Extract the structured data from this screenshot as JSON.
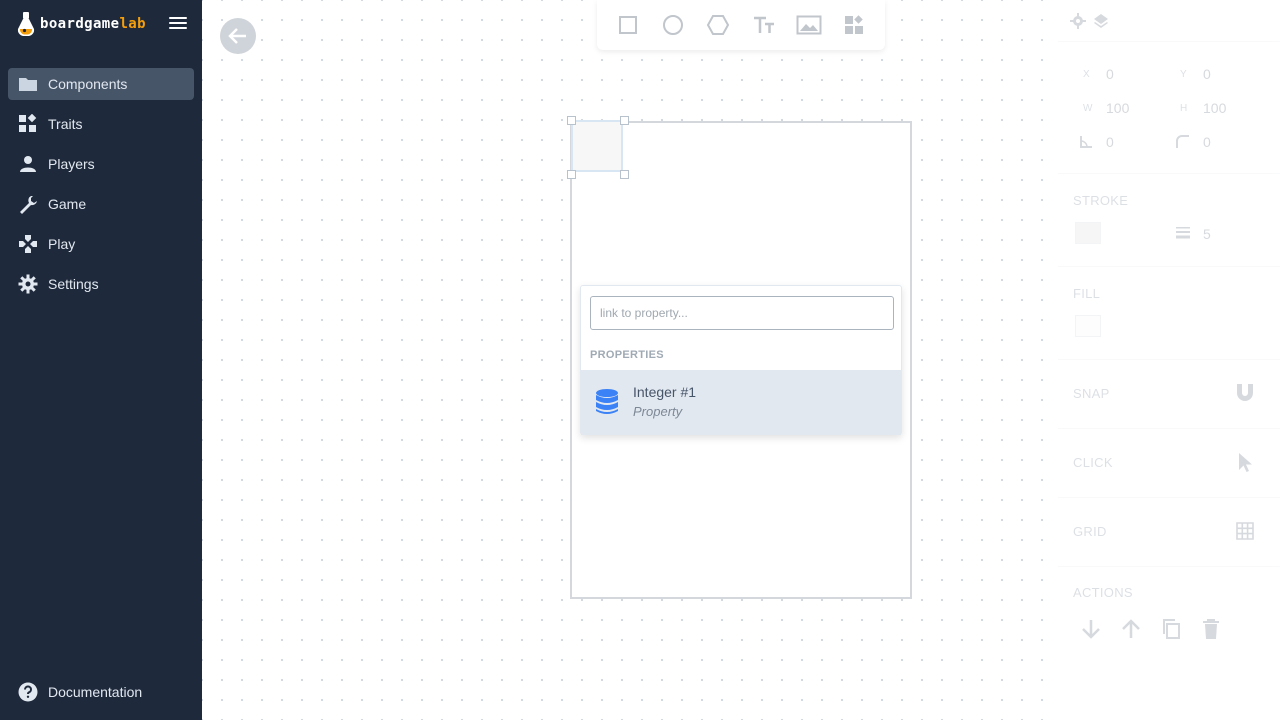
{
  "brand": {
    "name_main": "boardgame",
    "name_accent": "lab"
  },
  "colors": {
    "sidebar_bg": "#1e293b",
    "sidebar_active": "#475569",
    "accent": "#f59e0b",
    "dropdown_highlight": "#e2e8f0",
    "db_icon": "#3b82f6"
  },
  "sidebar": {
    "items": [
      {
        "label": "Components",
        "icon": "folder-icon",
        "active": true
      },
      {
        "label": "Traits",
        "icon": "widgets-icon",
        "active": false
      },
      {
        "label": "Players",
        "icon": "person-icon",
        "active": false
      },
      {
        "label": "Game",
        "icon": "wrench-icon",
        "active": false
      },
      {
        "label": "Play",
        "icon": "gamepad-icon",
        "active": false
      },
      {
        "label": "Settings",
        "icon": "gear-icon",
        "active": false
      }
    ],
    "footer": {
      "label": "Documentation",
      "icon": "help-icon"
    }
  },
  "toolbar": {
    "tools": [
      "rectangle-tool-icon",
      "circle-tool-icon",
      "hexagon-tool-icon",
      "text-tool-icon",
      "image-tool-icon",
      "component-tool-icon"
    ]
  },
  "dropdown": {
    "placeholder": "link to property...",
    "section_label": "PROPERTIES",
    "options": [
      {
        "title": "Integer #1",
        "subtitle": "Property",
        "icon": "database-icon"
      }
    ]
  },
  "panel": {
    "tabs": [
      "gear-icon",
      "layers-icon"
    ],
    "position": {
      "x_label": "X",
      "x": "0",
      "y_label": "Y",
      "y": "0",
      "w_label": "W",
      "w": "100",
      "h_label": "H",
      "h": "100",
      "rotation": "0",
      "radius": "0"
    },
    "stroke": {
      "title": "STROKE",
      "width": "5",
      "color": "#d9d9d9"
    },
    "fill": {
      "title": "FILL",
      "color": "#f7f7f7"
    },
    "snap": {
      "title": "SNAP"
    },
    "click": {
      "title": "CLICK"
    },
    "grid": {
      "title": "GRID"
    },
    "actions": {
      "title": "ACTIONS"
    }
  }
}
